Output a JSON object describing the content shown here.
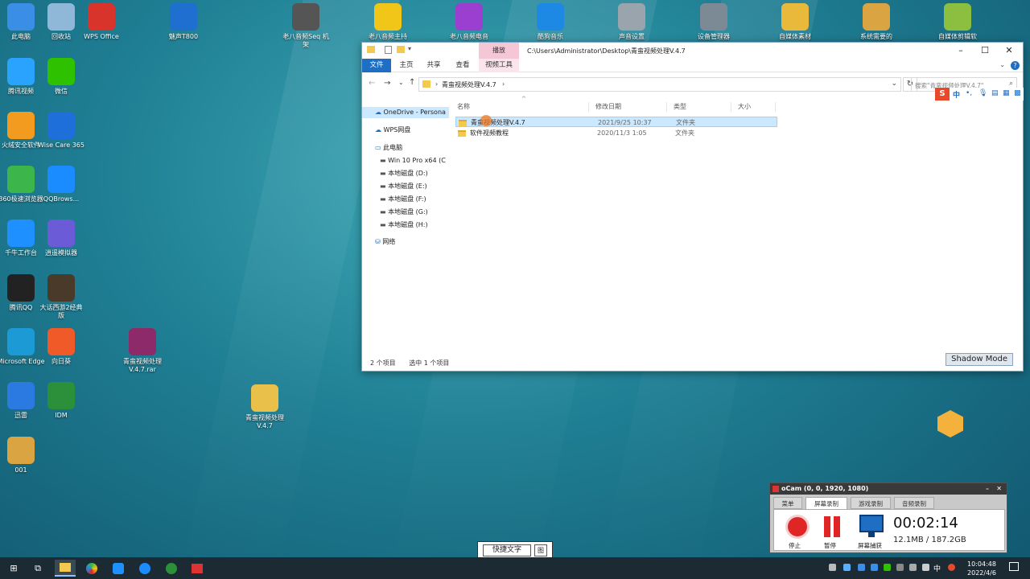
{
  "desktop": {
    "icons_left": [
      {
        "label": "此电脑",
        "icon": "computer-icon",
        "color": "#3a8ee6"
      },
      {
        "label": "回收站",
        "icon": "recycle-bin-icon",
        "color": "#8fb8d8"
      },
      {
        "label": "WPS Office",
        "icon": "wps-icon",
        "color": "#d9342b"
      },
      {
        "label": "腾讯视频",
        "icon": "tencent-video-icon",
        "color": "#2aa3ff"
      },
      {
        "label": "微信",
        "icon": "wechat-icon",
        "color": "#2dc100"
      },
      {
        "label": "火绒安全软件",
        "icon": "huorong-icon",
        "color": "#f29b1e"
      },
      {
        "label": "Wise Care 365",
        "icon": "wise-care-icon",
        "color": "#1e6fd9"
      },
      {
        "label": "360极速浏览器",
        "icon": "browser-360-icon",
        "color": "#3cb54a"
      },
      {
        "label": "QQBrows...",
        "icon": "qq-browser-icon",
        "color": "#1a8cff"
      },
      {
        "label": "千牛工作台",
        "icon": "qianniu-icon",
        "color": "#1e90ff"
      },
      {
        "label": "逍遥模拟器",
        "icon": "xiaoyao-icon",
        "color": "#6b5bd6"
      },
      {
        "label": "腾讯QQ",
        "icon": "qq-icon",
        "color": "#222222"
      },
      {
        "label": "大话西游2经典版",
        "icon": "game-icon",
        "color": "#4a3a2a"
      },
      {
        "label": "Microsoft Edge",
        "icon": "edge-icon",
        "color": "#1b9ad6"
      },
      {
        "label": "向日葵",
        "icon": "sunflower-icon",
        "color": "#f05a28"
      },
      {
        "label": "迅雷",
        "icon": "xunlei-icon",
        "color": "#2a7ae2"
      },
      {
        "label": "IDM",
        "icon": "idm-icon",
        "color": "#2c8f3a"
      },
      {
        "label": "001",
        "icon": "document-icon",
        "color": "#d9a441"
      }
    ],
    "icons_top": [
      {
        "label": "魅声T800",
        "icon": "meisheng-icon",
        "color": "#1f6fd1"
      },
      {
        "label": "老八音频Seq 机架",
        "icon": "audio-rack-icon",
        "color": "#555555"
      },
      {
        "label": "老八音频主持",
        "icon": "music-icon",
        "color": "#f2c618"
      },
      {
        "label": "老八音频电音",
        "icon": "search-audio-icon",
        "color": "#9b3fd1"
      },
      {
        "label": "酷狗音乐",
        "icon": "kugou-icon",
        "color": "#1e88e5"
      },
      {
        "label": "声音设置",
        "icon": "speaker-icon",
        "color": "#9aa4ad"
      },
      {
        "label": "设备管理器",
        "icon": "device-manager-icon",
        "color": "#7c8a95"
      },
      {
        "label": "自媒体素材",
        "icon": "folder-icon",
        "color": "#e8b93a"
      },
      {
        "label": "系统需要的",
        "icon": "folder-zip-icon",
        "color": "#d9a441"
      },
      {
        "label": "自媒体剪辑软",
        "icon": "folder-zip-icon",
        "color": "#8cbf3f"
      }
    ],
    "icons_mid": [
      {
        "label": "青蛮视频处理V.4.7.rar",
        "icon": "winrar-icon",
        "color": "#8c2a6a"
      },
      {
        "label": "青蛮视频处理V.4.7",
        "icon": "folder-icon",
        "color": "#e8c04a"
      }
    ]
  },
  "explorer": {
    "context_tab": "播放",
    "path_title": "C:\\Users\\Administrator\\Desktop\\青蛮视频处理V.4.7",
    "ribbon_tabs": [
      "文件",
      "主页",
      "共享",
      "查看",
      "视频工具"
    ],
    "address": "青蛮视频处理V.4.7",
    "search_placeholder": "搜索\"青蛮视频处理V.4.7\"",
    "nav": [
      "OneDrive - Persona",
      "WPS网盘",
      "此电脑",
      "Win 10 Pro x64 (C",
      "本地磁盘 (D:)",
      "本地磁盘 (E:)",
      "本地磁盘 (F:)",
      "本地磁盘 (G:)",
      "本地磁盘 (H:)",
      "网络"
    ],
    "columns": [
      "名称",
      "修改日期",
      "类型",
      "大小"
    ],
    "files": [
      {
        "name": "青蛮视频处理V.4.7",
        "date": "2021/9/25 10:37",
        "type": "文件夹",
        "size": ""
      },
      {
        "name": "软件视频教程",
        "date": "2020/11/3 1:05",
        "type": "文件夹",
        "size": ""
      }
    ],
    "status_count": "2 个项目",
    "status_selected": "选中 1 个项目",
    "shadow_mode": "Shadow Mode"
  },
  "ime_bar": {
    "lang": "中"
  },
  "quick_text": {
    "button": "快捷文字",
    "icon_label": "图"
  },
  "ocam": {
    "title": "oCam (0, 0, 1920, 1080)",
    "tabs": [
      "菜单",
      "屏幕录制",
      "游戏录制",
      "音频录制"
    ],
    "buttons": [
      "停止",
      "暂停",
      "屏幕捕获"
    ],
    "timer": "00:02:14",
    "size": "12.1MB / 187.2GB"
  },
  "taskbar": {
    "time": "10:04:48",
    "date": "2022/4/6",
    "lang": "中"
  }
}
